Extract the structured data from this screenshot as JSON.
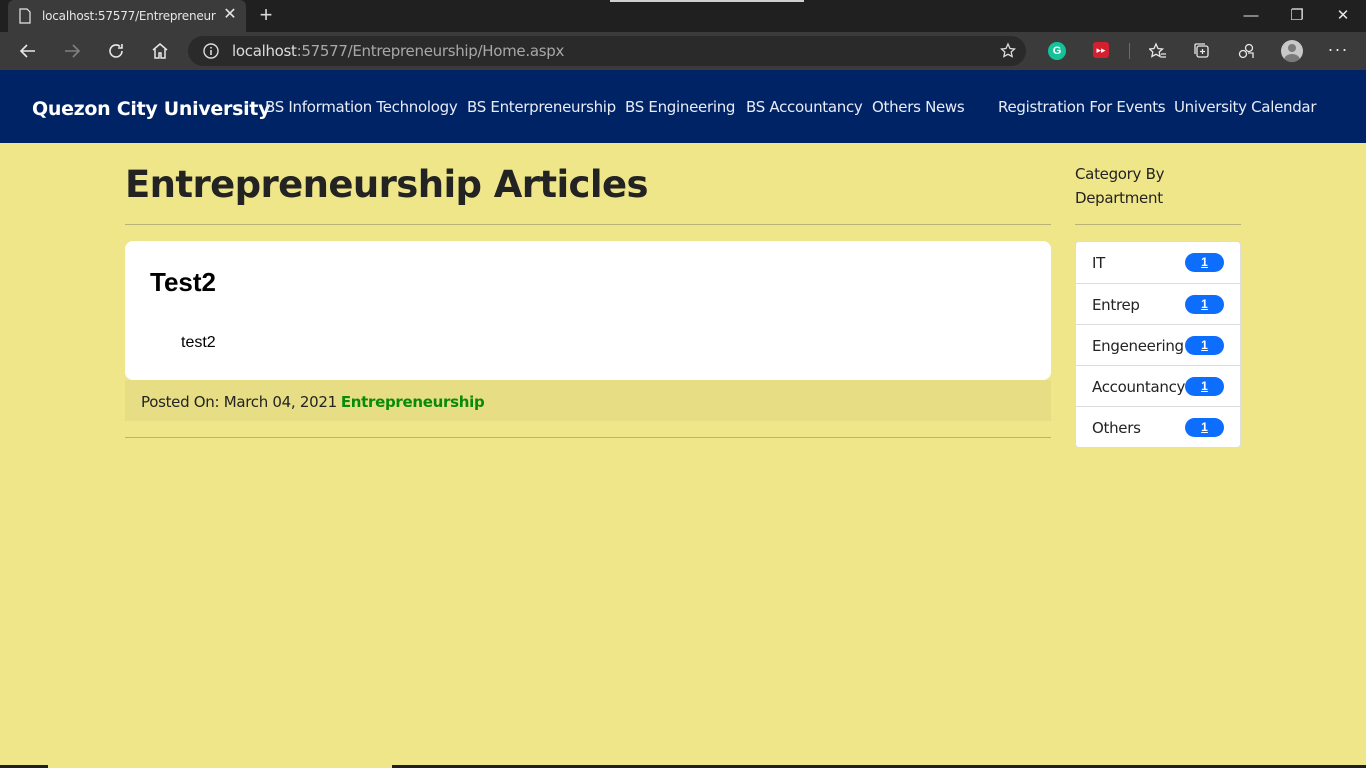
{
  "browser": {
    "tab_title": "localhost:57577/Entrepreneurship",
    "url_host": "localhost",
    "url_path": ":57577/Entrepreneurship/Home.aspx",
    "extension_grammarly_letter": "G"
  },
  "navbar": {
    "brand": "Quezon City University",
    "links": [
      {
        "label": "BS Information Technology"
      },
      {
        "label": "BS Enterpreneurship"
      },
      {
        "label": "BS Engineering"
      },
      {
        "label": "BS Accountancy"
      },
      {
        "label": "Others News"
      },
      {
        "label": "Registration For Events"
      },
      {
        "label": "University Calendar"
      }
    ],
    "background_color": "#002366"
  },
  "main": {
    "title": "Entrepreneurship Articles",
    "article": {
      "title": "Test2",
      "body": "test2",
      "posted_label": "Posted On: March 04, 2021",
      "category": "Entrepreneurship"
    }
  },
  "sidebar": {
    "heading": "Category By Department",
    "categories": [
      {
        "label": "IT",
        "count": "1"
      },
      {
        "label": "Entrep",
        "count": "1"
      },
      {
        "label": "Engeneering",
        "count": "1"
      },
      {
        "label": "Accountancy",
        "count": "1"
      },
      {
        "label": "Others",
        "count": "1"
      }
    ]
  },
  "colors": {
    "page_background": "#efe68a",
    "badge": "#0d6efd",
    "category_link": "#0a8a0a"
  }
}
